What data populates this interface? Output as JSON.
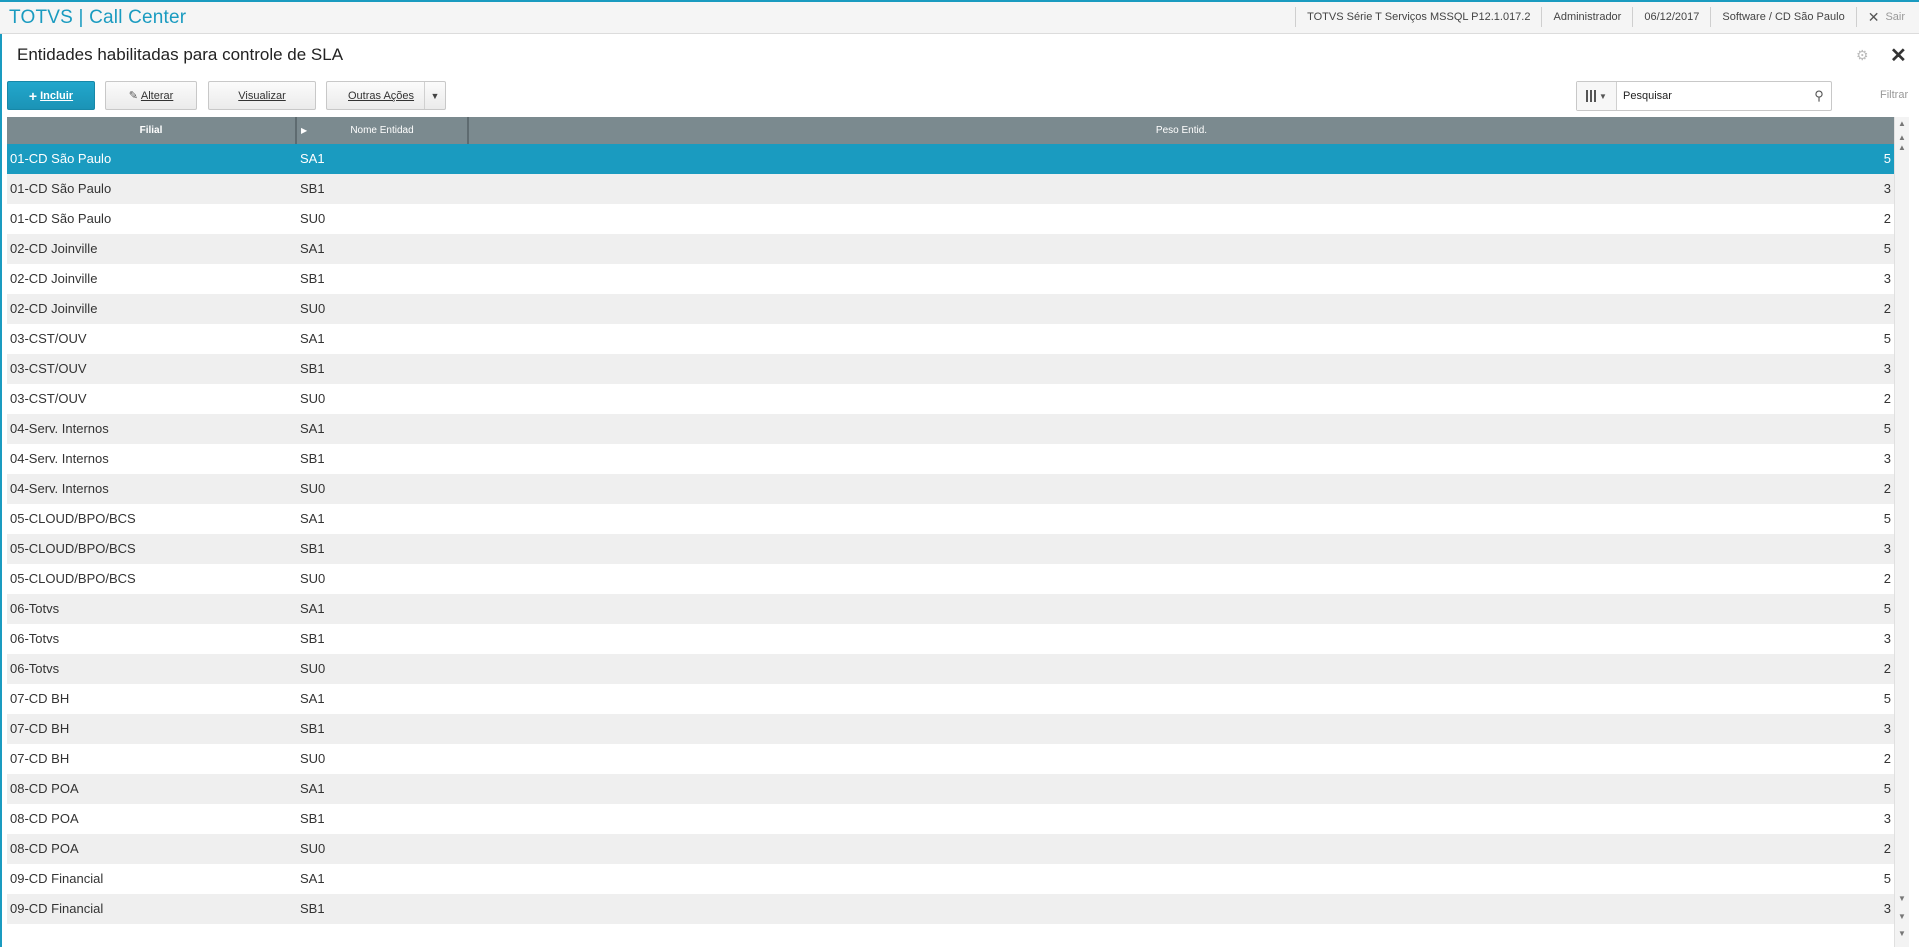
{
  "app": {
    "title": "TOTVS | Call Center"
  },
  "topbar": {
    "info": [
      "TOTVS Série T Serviços MSSQL P12.1.017.2",
      "Administrador",
      "06/12/2017",
      "Software / CD São Paulo"
    ],
    "exit_label": "Sair"
  },
  "page": {
    "title": "Entidades habilitadas para controle de SLA"
  },
  "toolbar": {
    "incluir_label": "Incluir",
    "alterar_label": "Alterar",
    "visualizar_label": "Visualizar",
    "outras_acoes_label": "Outras Ações"
  },
  "search": {
    "placeholder": "Pesquisar",
    "filter_label": "Filtrar"
  },
  "grid": {
    "columns": [
      "Filial",
      "Nome Entidad",
      "Peso Entid."
    ],
    "selected_row": 0,
    "rows": [
      {
        "filial": "01-CD São Paulo",
        "nome": "SA1",
        "peso": "5"
      },
      {
        "filial": "01-CD São Paulo",
        "nome": "SB1",
        "peso": "3"
      },
      {
        "filial": "01-CD São Paulo",
        "nome": "SU0",
        "peso": "2"
      },
      {
        "filial": "02-CD Joinville",
        "nome": "SA1",
        "peso": "5"
      },
      {
        "filial": "02-CD Joinville",
        "nome": "SB1",
        "peso": "3"
      },
      {
        "filial": "02-CD Joinville",
        "nome": "SU0",
        "peso": "2"
      },
      {
        "filial": "03-CST/OUV",
        "nome": "SA1",
        "peso": "5"
      },
      {
        "filial": "03-CST/OUV",
        "nome": "SB1",
        "peso": "3"
      },
      {
        "filial": "03-CST/OUV",
        "nome": "SU0",
        "peso": "2"
      },
      {
        "filial": "04-Serv. Internos",
        "nome": "SA1",
        "peso": "5"
      },
      {
        "filial": "04-Serv. Internos",
        "nome": "SB1",
        "peso": "3"
      },
      {
        "filial": "04-Serv. Internos",
        "nome": "SU0",
        "peso": "2"
      },
      {
        "filial": "05-CLOUD/BPO/BCS",
        "nome": "SA1",
        "peso": "5"
      },
      {
        "filial": "05-CLOUD/BPO/BCS",
        "nome": "SB1",
        "peso": "3"
      },
      {
        "filial": "05-CLOUD/BPO/BCS",
        "nome": "SU0",
        "peso": "2"
      },
      {
        "filial": "06-Totvs",
        "nome": "SA1",
        "peso": "5"
      },
      {
        "filial": "06-Totvs",
        "nome": "SB1",
        "peso": "3"
      },
      {
        "filial": "06-Totvs",
        "nome": "SU0",
        "peso": "2"
      },
      {
        "filial": "07-CD BH",
        "nome": "SA1",
        "peso": "5"
      },
      {
        "filial": "07-CD BH",
        "nome": "SB1",
        "peso": "3"
      },
      {
        "filial": "07-CD BH",
        "nome": "SU0",
        "peso": "2"
      },
      {
        "filial": "08-CD POA",
        "nome": "SA1",
        "peso": "5"
      },
      {
        "filial": "08-CD POA",
        "nome": "SB1",
        "peso": "3"
      },
      {
        "filial": "08-CD POA",
        "nome": "SU0",
        "peso": "2"
      },
      {
        "filial": "09-CD Financial",
        "nome": "SA1",
        "peso": "5"
      },
      {
        "filial": "09-CD Financial",
        "nome": "SB1",
        "peso": "3"
      }
    ]
  },
  "colors": {
    "accent": "#1a9bc0",
    "header_bg": "#7b8a8f",
    "row_alt": "#efefef"
  },
  "icons": [
    "plus-icon",
    "pencil-icon",
    "gear-icon",
    "close-icon",
    "columns-icon",
    "search-icon",
    "caret-down-icon",
    "scroll-up-icon",
    "scroll-down-icon"
  ]
}
